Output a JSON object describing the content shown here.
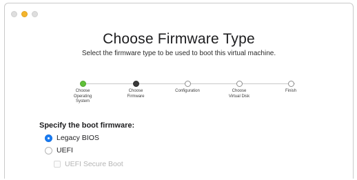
{
  "window": {
    "traffic_lights": {
      "close_color": "#dedede",
      "minimize_color": "#f4b52d",
      "zoom_color": "#dedede"
    }
  },
  "header": {
    "title": "Choose Firmware Type",
    "subtitle": "Select the firmware type to be used to boot this virtual machine."
  },
  "steps": [
    {
      "label": "Choose\nOperating\nSystem",
      "state": "done"
    },
    {
      "label": "Choose\nFirmware",
      "state": "current"
    },
    {
      "label": "Configuration",
      "state": "todo"
    },
    {
      "label": "Choose\nVirtual Disk",
      "state": "todo"
    },
    {
      "label": "Finish",
      "state": "todo"
    }
  ],
  "firmware": {
    "section_label": "Specify the boot firmware:",
    "options": [
      {
        "label": "Legacy BIOS",
        "selected": true
      },
      {
        "label": "UEFI",
        "selected": false
      }
    ],
    "secure_boot": {
      "label": "UEFI Secure Boot",
      "checked": false,
      "enabled": false
    }
  },
  "colors": {
    "accent": "#1a7cf3",
    "step_done": "#5fc038",
    "step_current": "#3a3a3a"
  }
}
